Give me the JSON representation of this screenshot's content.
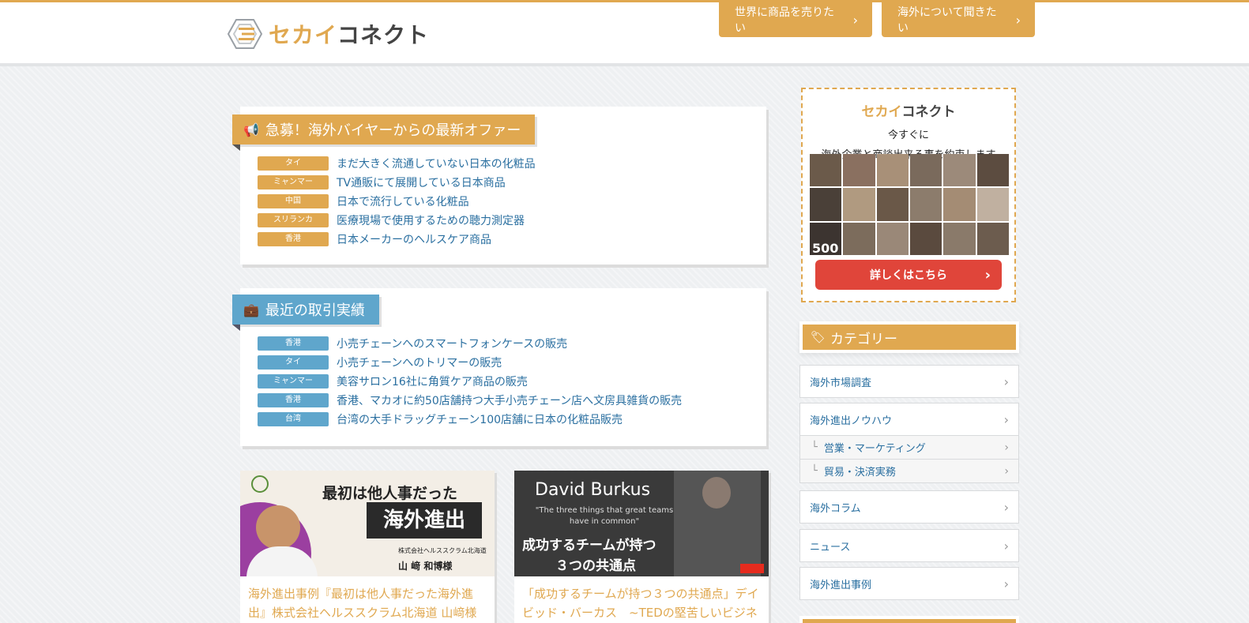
{
  "header": {
    "logo_part1": "セカイ",
    "logo_part2": "コネクト",
    "btn_sell": "世界に商品を売りたい",
    "btn_ask": "海外について聞きたい"
  },
  "offers": {
    "title": "急募！海外バイヤーからの最新オファー",
    "items": [
      {
        "country": "タイ",
        "text": "まだ大きく流通していない日本の化粧品"
      },
      {
        "country": "ミャンマー",
        "text": "TV通販にて展開している日本商品"
      },
      {
        "country": "中国",
        "text": "日本で流行している化粧品"
      },
      {
        "country": "スリランカ",
        "text": "医療現場で使用するための聴力測定器"
      },
      {
        "country": "香港",
        "text": "日本メーカーのヘルスケア商品"
      }
    ]
  },
  "deals": {
    "title": "最近の取引実績",
    "items": [
      {
        "country": "香港",
        "text": "小売チェーンへのスマートフォンケースの販売"
      },
      {
        "country": "タイ",
        "text": "小売チェーンへのトリマーの販売"
      },
      {
        "country": "ミャンマー",
        "text": "美容サロン16社に角質ケア商品の販売"
      },
      {
        "country": "香港",
        "text": "香港、マカオに約50店舗持つ大手小売チェーン店へ文房具雑貨の販売"
      },
      {
        "country": "台湾",
        "text": "台湾の大手ドラッグチェーン100店舗に日本の化粧品販売"
      }
    ]
  },
  "articles": [
    {
      "thumb_line1": "最初は他人事だった",
      "thumb_line2": "海外進出",
      "thumb_company": "株式会社ヘルススクラム北海道",
      "thumb_name": "山 﨑 和博様",
      "title": "海外進出事例『最初は他人事だった海外進出』株式会社ヘルススクラム北海道 山﨑様"
    },
    {
      "thumb_name": "David Burkus",
      "thumb_quote": "\"The three things that great teams have in common\"",
      "thumb_line1": "成功するチームが持つ",
      "thumb_line2": "３つの共通点",
      "title": "「成功するチームが持つ３つの共通点」デイビッド・バーカス　~TEDの堅苦しいビジネ"
    }
  ],
  "sidebar": {
    "ad_logo_part1": "セカイ",
    "ad_logo_part2": "コネクト",
    "ad_line1": "今すぐに",
    "ad_line2": "海外企業と商談出来る事を約束します",
    "ad_count": "500",
    "ad_cta": "詳しくはこちら",
    "category_title": "カテゴリー",
    "categories": [
      {
        "label": "海外市場調査"
      },
      {
        "label": "海外進出ノウハウ"
      },
      {
        "label": "営業・マーケティング"
      },
      {
        "label": "貿易・決済実務"
      },
      {
        "label": "海外コラム"
      },
      {
        "label": "ニュース"
      },
      {
        "label": "海外進出事例"
      }
    ]
  },
  "colors": {
    "accent": "#e0a850",
    "blue": "#5fa6cc",
    "link": "#2a6fa0",
    "cta": "#e0453a"
  }
}
